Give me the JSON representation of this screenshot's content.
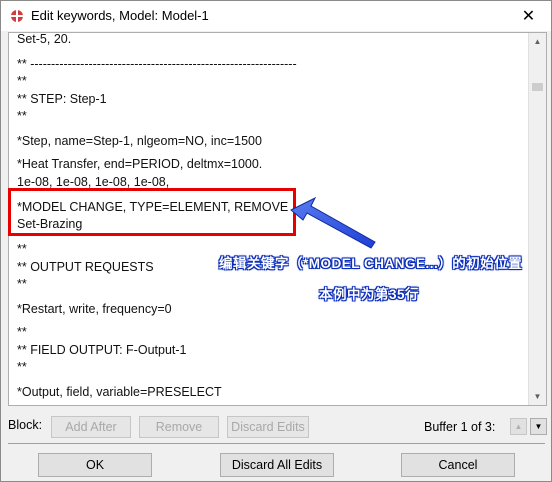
{
  "window": {
    "title": "Edit keywords, Model: Model-1",
    "close_glyph": "✕",
    "icon": "abaqus-app-icon"
  },
  "editor": {
    "lines": [
      "Set-5, 20.",
      "** ----------------------------------------------------------------",
      "**",
      "** STEP: Step-1",
      "**",
      "*Step, name=Step-1, nlgeom=NO, inc=1500",
      "*Heat Transfer, end=PERIOD, deltmx=1000.",
      "1e-08, 1e-08, 1e-08, 1e-08,",
      "*MODEL CHANGE, TYPE=ELEMENT, REMOVE",
      "Set-Brazing",
      "**",
      "** OUTPUT REQUESTS",
      "**",
      "*Restart, write, frequency=0",
      "**",
      "** FIELD OUTPUT: F-Output-1",
      "**",
      "*Output, field, variable=PRESELECT"
    ]
  },
  "annotation": {
    "line1": "编辑关键字（*MODEL CHANGE...）的初始位置",
    "line2": "本例中为第35行",
    "highlight_color": "#e60000",
    "arrow_color": "#1d3fd6"
  },
  "block_bar": {
    "label": "Block:",
    "add_after": "Add After",
    "remove": "Remove",
    "discard_edits": "Discard Edits",
    "buffer": "Buffer 1 of 3:"
  },
  "footer": {
    "ok": "OK",
    "discard_all": "Discard All Edits",
    "cancel": "Cancel"
  }
}
